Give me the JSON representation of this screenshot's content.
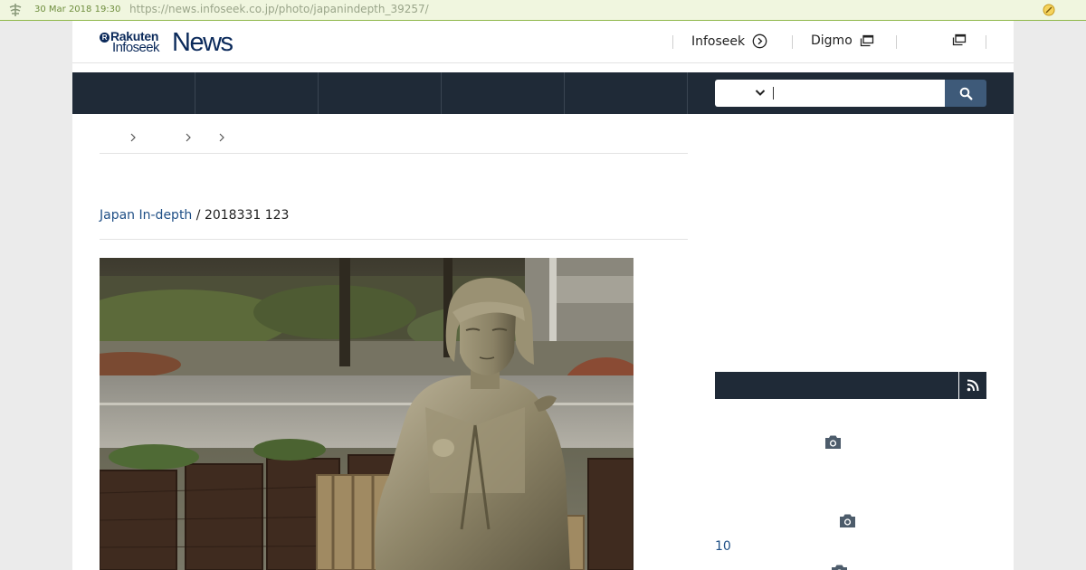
{
  "archive_bar": {
    "date": "30 Mar 2018 19:30",
    "url": "https://news.infoseek.co.jp/photo/japanindepth_39257/"
  },
  "logo": {
    "rakuten": "Rakuten",
    "infoseek": "Infoseek",
    "news": "News"
  },
  "header_links": {
    "infoseek": "Infoseek",
    "digmo": "Digmo"
  },
  "search": {
    "placeholder": ""
  },
  "article": {
    "source": "Japan In-depth",
    "separator": " / ",
    "date": "2018331 123"
  },
  "sidebar": {
    "item_count_label": "10"
  },
  "icons": {
    "search": "search-icon",
    "rss": "rss-icon",
    "camera": "camera-icon",
    "arrow_circle": "arrow-circle-right-icon",
    "new_window": "new-window-icon",
    "chevron": "chevron-down-icon"
  },
  "colors": {
    "nav_bg": "#1f2a37",
    "search_button": "#3e5a79",
    "link": "#1f4f86",
    "archive_bar_bg": "#f0f6df"
  }
}
